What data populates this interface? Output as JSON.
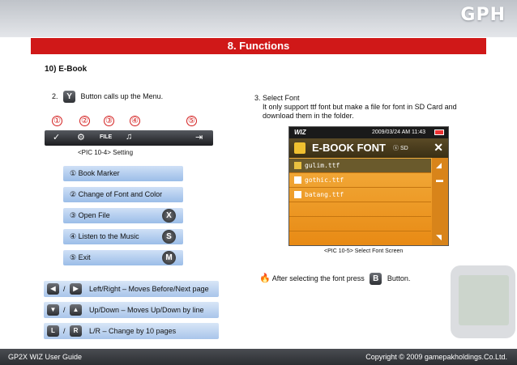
{
  "header": {
    "logo": "GPH",
    "title": "8. Functions"
  },
  "section": {
    "title": "10) E-Book"
  },
  "left": {
    "step2": {
      "number": "2.",
      "button": "Y",
      "text": "Button calls up the Menu."
    },
    "numbers": [
      "①",
      "②",
      "③",
      "④",
      "⑤"
    ],
    "setting_icons": {
      "file": "FILE"
    },
    "setting_caption": "<PIC 10-4> Setting",
    "menu": [
      {
        "label": "① Book Marker"
      },
      {
        "label": "② Change of Font and Color"
      },
      {
        "label": "③ Open File",
        "button": "X"
      },
      {
        "label": "④ Listen to the Music",
        "button": "S"
      },
      {
        "label": "⑤ Exit",
        "button": "M"
      }
    ],
    "nav": [
      {
        "slash": "/",
        "text": "Left/Right – Moves Before/Next page"
      },
      {
        "slash": "/",
        "text": "Up/Down – Moves Up/Down by line"
      },
      {
        "keys": [
          "L",
          "R"
        ],
        "slash": "/",
        "text": "L/R – Change by 10 pages"
      }
    ]
  },
  "right": {
    "step3": {
      "title": "3. Select Font",
      "line1": "It only support ttf font but make a file for font in SD Card and",
      "line2": "download them in the folder."
    },
    "screen": {
      "brand": "WIZ",
      "datetime": "2009/03/24 AM 11:43",
      "title": "E-BOOK FONT",
      "sd": "SD",
      "fonts": [
        "gulim.ttf",
        "gothic.ttf",
        "batang.ttf"
      ]
    },
    "screen_caption": "<PIC 10-5> Select Font Screen",
    "note": {
      "before": "After selecting the font press",
      "button": "B",
      "after": "Button."
    }
  },
  "footer": {
    "left": "GP2X WIZ User Guide",
    "right": "Copyright © 2009 gamepakholdings.Co.Ltd."
  },
  "colors": {
    "title_bar": "#d01818",
    "menu_item": "#b5cfee",
    "screen_accent": "#f0a030"
  }
}
